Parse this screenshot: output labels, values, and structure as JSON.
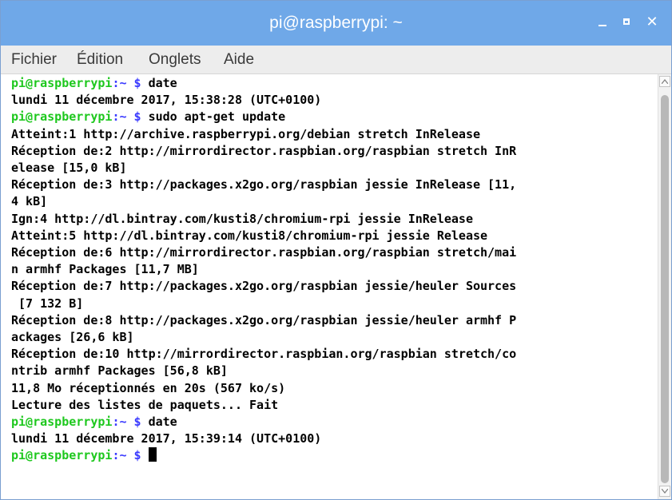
{
  "window": {
    "title": "pi@raspberrypi: ~",
    "controls": {
      "minimize_icon": "minimize-icon",
      "maximize_icon": "maximize-icon",
      "close_label": "✕"
    }
  },
  "menu": {
    "items": [
      "Fichier",
      "Édition",
      "Onglets",
      "Aide"
    ]
  },
  "prompt": {
    "user": "pi@raspberrypi",
    "path": ":~",
    "dollar": " $ "
  },
  "terminal": {
    "lines": [
      {
        "type": "cmd",
        "text": "date"
      },
      {
        "type": "out",
        "text": "lundi 11 décembre 2017, 15:38:28 (UTC+0100)"
      },
      {
        "type": "cmd",
        "text": "sudo apt-get update"
      },
      {
        "type": "out",
        "text": "Atteint:1 http://archive.raspberrypi.org/debian stretch InRelease"
      },
      {
        "type": "out",
        "text": "Réception de:2 http://mirrordirector.raspbian.org/raspbian stretch InR"
      },
      {
        "type": "out",
        "text": "elease [15,0 kB]"
      },
      {
        "type": "out",
        "text": "Réception de:3 http://packages.x2go.org/raspbian jessie InRelease [11,"
      },
      {
        "type": "out",
        "text": "4 kB]"
      },
      {
        "type": "out",
        "text": "Ign:4 http://dl.bintray.com/kusti8/chromium-rpi jessie InRelease"
      },
      {
        "type": "out",
        "text": "Atteint:5 http://dl.bintray.com/kusti8/chromium-rpi jessie Release"
      },
      {
        "type": "out",
        "text": "Réception de:6 http://mirrordirector.raspbian.org/raspbian stretch/mai"
      },
      {
        "type": "out",
        "text": "n armhf Packages [11,7 MB]"
      },
      {
        "type": "out",
        "text": "Réception de:7 http://packages.x2go.org/raspbian jessie/heuler Sources"
      },
      {
        "type": "out",
        "text": " [7 132 B]"
      },
      {
        "type": "out",
        "text": "Réception de:8 http://packages.x2go.org/raspbian jessie/heuler armhf P"
      },
      {
        "type": "out",
        "text": "ackages [26,6 kB]"
      },
      {
        "type": "out",
        "text": "Réception de:10 http://mirrordirector.raspbian.org/raspbian stretch/co"
      },
      {
        "type": "out",
        "text": "ntrib armhf Packages [56,8 kB]"
      },
      {
        "type": "out",
        "text": "11,8 Mo réceptionnés en 20s (567 ko/s)"
      },
      {
        "type": "out",
        "text": "Lecture des listes de paquets... Fait"
      },
      {
        "type": "cmd",
        "text": "date"
      },
      {
        "type": "out",
        "text": "lundi 11 décembre 2017, 15:39:14 (UTC+0100)"
      },
      {
        "type": "cmd",
        "text": "",
        "cursor": true
      }
    ]
  },
  "colors": {
    "titlebar": "#6fa8e8",
    "prompt_user": "#1ec81e",
    "prompt_path": "#3a3aff"
  }
}
